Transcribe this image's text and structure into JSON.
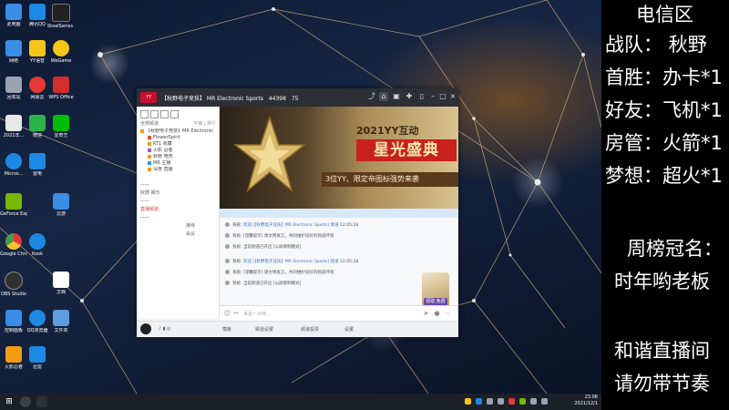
{
  "desktop": {
    "icons": [
      {
        "label": "此电脑",
        "icon": "computer-icon",
        "color": "#3a8ee6"
      },
      {
        "label": "网络",
        "icon": "network-icon",
        "color": "#3a8ee6"
      },
      {
        "label": "回收站",
        "icon": "recycle-bin-icon",
        "color": "#9aa3b2"
      },
      {
        "label": "2021年...",
        "icon": "document-icon",
        "color": "#e8e8e8"
      },
      {
        "label": "Micros...",
        "icon": "edge-icon",
        "color": "#1e88e5"
      },
      {
        "label": "GeForce Experience",
        "icon": "nvidia-icon",
        "color": "#76b900"
      },
      {
        "label": "Google Chrome",
        "icon": "chrome-icon",
        "color": "#e53935"
      },
      {
        "label": "OBS Studio",
        "icon": "obs-icon",
        "color": "#303030"
      },
      {
        "label": "控制面板",
        "icon": "control-panel-icon",
        "color": "#3a8ee6"
      },
      {
        "label": "火影忍者",
        "icon": "game-icon",
        "color": "#f39c12"
      },
      {
        "label": "腾讯QQ",
        "icon": "qq-icon",
        "color": "#1e88e5"
      },
      {
        "label": "YY语音",
        "icon": "yy-icon",
        "color": "#f5c518"
      },
      {
        "label": "网易云",
        "icon": "netease-icon",
        "color": "#e53935"
      },
      {
        "label": "微信",
        "icon": "wechat-icon",
        "color": "#2eb34a"
      },
      {
        "label": "雷电",
        "icon": "thunder-icon",
        "color": "#1e88e5"
      },
      {
        "label": "Kook",
        "icon": "kook-icon",
        "color": "#1e88e5"
      },
      {
        "label": "QQ浏览器",
        "icon": "qq-browser-icon",
        "color": "#1e88e5"
      },
      {
        "label": "迅雷",
        "icon": "xunlei-icon",
        "color": "#1e88e5"
      },
      {
        "label": "SteelSeries GG",
        "icon": "steelseries-icon",
        "color": "#222"
      },
      {
        "label": "WeGame",
        "icon": "wegame-icon",
        "color": "#f5c518"
      },
      {
        "label": "WPS Office",
        "icon": "wps-icon",
        "color": "#d32f2f"
      },
      {
        "label": "爱奇艺",
        "icon": "iqiyi-icon",
        "color": "#00be06"
      },
      {
        "label": "云游",
        "icon": "cloud-icon",
        "color": "#3a8ee6"
      },
      {
        "label": "文档",
        "icon": "file-icon",
        "color": "#ffffff"
      },
      {
        "label": "文件夹",
        "icon": "folder-icon",
        "color": "#5c9ede"
      }
    ]
  },
  "window": {
    "logo_text": "YY",
    "title": "【秋野电子竞技】 MR Electronic Sports",
    "channel_id": "44398",
    "online": "75"
  },
  "sidebar": {
    "section_label": "全部频道",
    "section_right": "平铺 | 排行",
    "channels": [
      "【秋野电子竞技】MR Electronic",
      "FlowerSpirit",
      "KT1 收藏",
      "火影 忍者",
      "秋野 电竞",
      "MR 主播",
      "深夜 直播"
    ],
    "subchannels": [
      {
        "text": "——",
        "red": false
      },
      {
        "text": "秋野 娱乐",
        "red": false
      },
      {
        "text": "——",
        "red": false
      },
      {
        "text": "直播频道",
        "red": true
      },
      {
        "text": "——",
        "red": false
      },
      {
        "text": "接待",
        "red": false
      },
      {
        "text": "会议",
        "red": false
      }
    ]
  },
  "banner": {
    "year_line": "2021YY互动",
    "headline": "星光盛典",
    "subline": "3位YY、限定帝图标强势来袭"
  },
  "chat": {
    "messages": [
      {
        "from": "系统:",
        "body": "欢迎 [【秋野电子竞技】MR Electronic Sports] 频道",
        "time": "12:05:28"
      },
      {
        "from": "系统:",
        "body": "[温馨提示] 请文明发言，共同维护良好的频道环境",
        "time": ""
      },
      {
        "from": "系统:",
        "body": "当前频道已开启 [公屏限制模式]",
        "time": ""
      },
      {
        "from": "系统:",
        "body": "欢迎 [【秋野电子竞技】MR Electronic Sports] 频道",
        "time": "12:05:28"
      },
      {
        "from": "系统:",
        "body": "[温馨提示] 请文明发言，共同维护良好的频道环境",
        "time": ""
      },
      {
        "from": "系统:",
        "body": "当前频道已开启 [公屏限制模式]",
        "time": ""
      }
    ],
    "badge_text": "领取 免费用"
  },
  "input": {
    "placeholder": "来说一点吧..."
  },
  "bottom": {
    "items": [
      "模板",
      "频道设置",
      "频道投票",
      "设置"
    ]
  },
  "taskbar": {
    "time": "23:06",
    "date": "2021/12/1"
  },
  "overlay": {
    "lines": [
      "电信区",
      "战队：  秋野",
      "首胜：办卡*1",
      "好友：飞机*1",
      "房管：火箭*1",
      "梦想：超火*1",
      "周榜冠名：",
      "时年哟老板",
      "和谐直播间",
      "请勿带节奏"
    ]
  }
}
